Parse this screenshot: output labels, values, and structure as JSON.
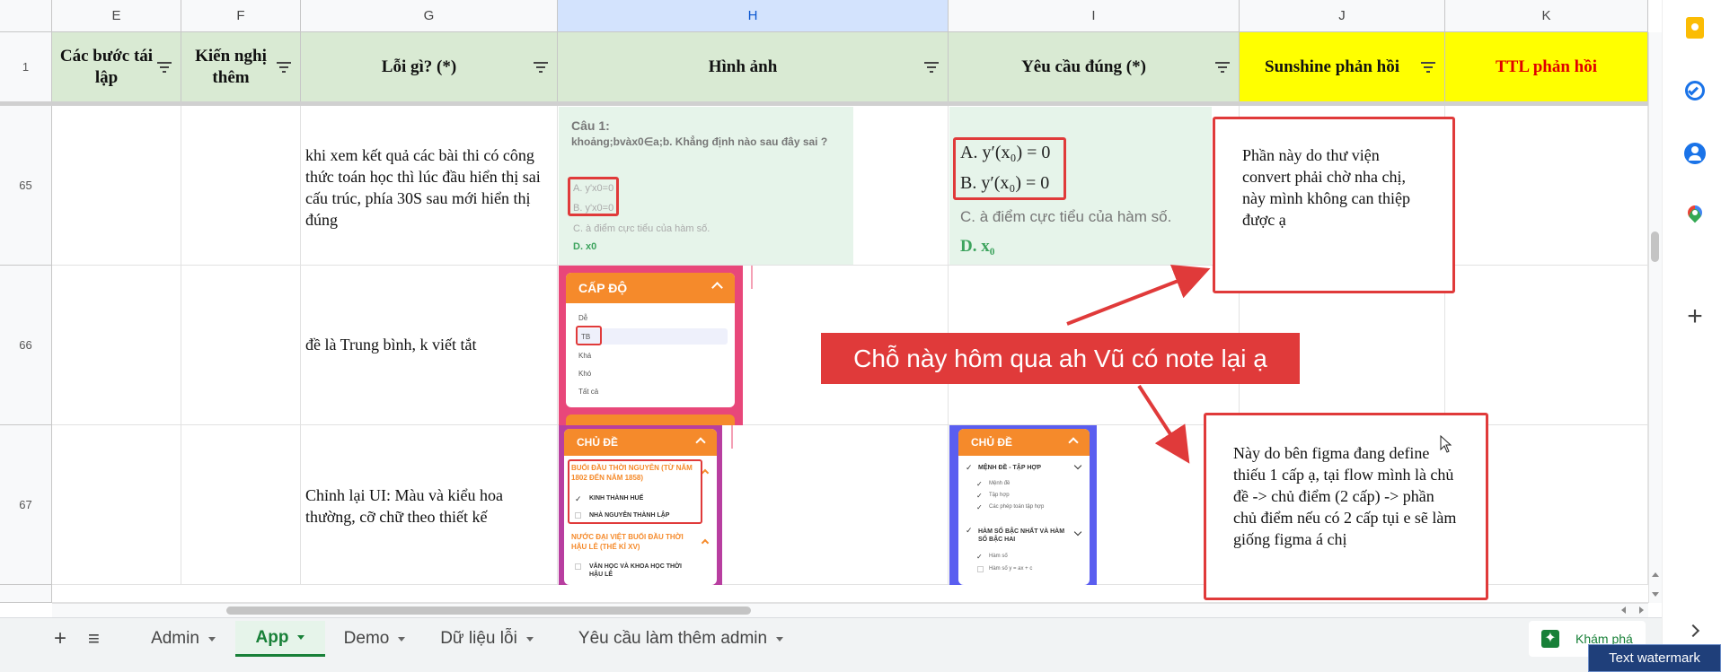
{
  "columns": {
    "e": "E",
    "f": "F",
    "g": "G",
    "h": "H",
    "i": "I",
    "j": "J",
    "k": "K"
  },
  "header_row": {
    "number": "1",
    "e": "Các bước tái lập",
    "f": "Kiến nghị thêm",
    "g": "Lỗi gì? (*)",
    "h": "Hình ảnh",
    "i": "Yêu cầu đúng (*)",
    "j": "Sunshine phản hồi",
    "k": "TTL phản hồi"
  },
  "rows": [
    {
      "number": "65",
      "g": "khi xem kết quả các bài thi có công thức toán học thì lúc đầu hiển thị sai cấu trúc, phía 30S sau mới hiển thị đúng",
      "h_image": {
        "question": "Câu 1:",
        "statement": "khoảng;bvàx0∈a;b. Khẳng định nào sau đây sai ?",
        "opt_a": "A. y'x0=0",
        "opt_b": "B. y'x0=0",
        "opt_c": "C. à điểm cực tiểu của hàm số.",
        "opt_d": "D. x0"
      },
      "i_image": {
        "opt_a": "A. y′(x₀) = 0",
        "opt_b": "B. y′(x₀) = 0",
        "opt_c": "C. à điểm cực tiểu của hàm số.",
        "opt_d": "D. x₀"
      }
    },
    {
      "number": "66",
      "g": "đề là Trung bình, k viết tắt",
      "h_image": {
        "title": "CẤP ĐỘ",
        "items": [
          "Dễ",
          "TB",
          "Khá",
          "Khó",
          "Tất cả"
        ]
      }
    },
    {
      "number": "67",
      "g": "Chỉnh lại UI: Màu và kiểu hoa thường, cỡ chữ theo thiết kế",
      "h_image": {
        "title": "CHỦ ĐỀ",
        "group1": "BUỔI ĐẦU THỜI NGUYỄN (TỪ NĂM 1802 ĐẾN NĂM 1858)",
        "item1": "KINH THÀNH HUẾ",
        "item2": "NHÀ NGUYỄN THÀNH LẬP",
        "group2": "NƯỚC ĐẠI VIỆT BUỔI ĐẦU THỜI HẬU LÊ (THẾ KỈ XV)",
        "item3": "VĂN HỌC VÀ KHOA HỌC THỜI HẬU LÊ"
      },
      "i_image": {
        "title": "CHỦ ĐỀ",
        "group1": "MỆNH ĐỀ - TẬP HỢP",
        "item1": "Mệnh đề",
        "item2": "Tập hợp",
        "item3": "Các phép toán tập hợp",
        "group2": "HÀM SỐ BẬC NHẤT VÀ HÀM SỐ BẬC HAI",
        "item4": "Hàm số",
        "item5": "Hàm số y = ax + c"
      }
    }
  ],
  "row68": "",
  "callouts": {
    "top": "Phần này do thư viện convert phải chờ nha chị, này mình không can thiệp được ạ",
    "bottom": "Này do bên figma đang define thiếu 1 cấp ạ, tại flow mình là chủ đề -> chủ điểm (2 cấp) -> phần chủ điểm nếu có 2 cấp tụi e sẽ làm giống figma á chị",
    "banner": "Chỗ này hôm qua ah Vũ có note lại ạ"
  },
  "sheet_tabs": {
    "add": "+",
    "all_sheets": "≡",
    "items": [
      "Admin",
      "App",
      "Demo",
      "Dữ liệu lỗi",
      "Yêu cầu làm thêm admin"
    ],
    "active": "App",
    "explore": "Khám phá"
  },
  "watermark": "Text watermark",
  "colors": {
    "header_green": "#d9ead3",
    "header_yellow": "#ffff00",
    "accent_red": "#e03a3a",
    "ttl_red": "#e00000",
    "active_tab": "#188038",
    "orange": "#f58a2b"
  },
  "side_panel_icons": [
    "keep-icon",
    "tasks-icon",
    "contacts-icon",
    "maps-icon",
    "add-icon"
  ]
}
